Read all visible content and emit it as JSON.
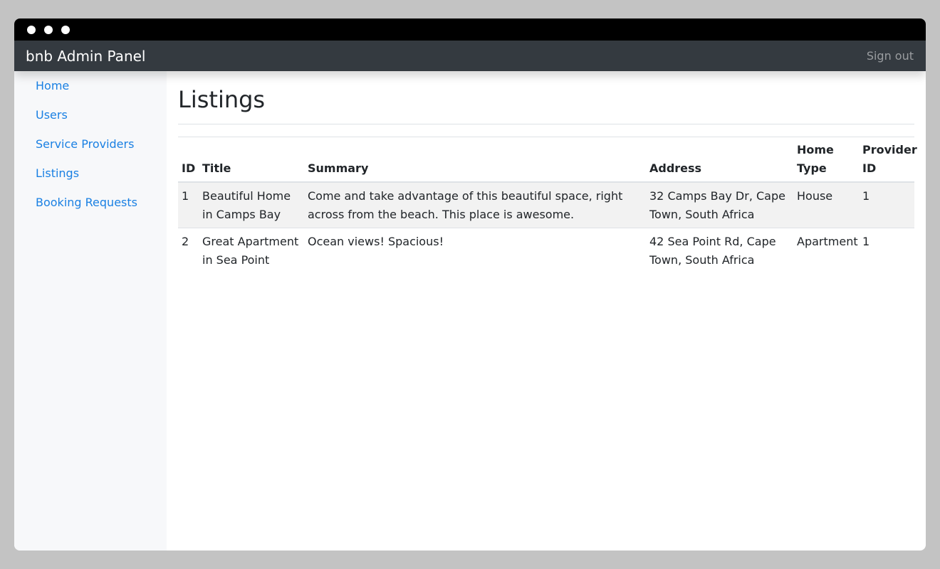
{
  "navbar": {
    "brand": "bnb Admin Panel",
    "sign_out": "Sign out"
  },
  "sidebar": {
    "items": [
      {
        "label": "Home"
      },
      {
        "label": "Users"
      },
      {
        "label": "Service Providers"
      },
      {
        "label": "Listings"
      },
      {
        "label": "Booking Requests"
      }
    ]
  },
  "main": {
    "title": "Listings",
    "table": {
      "headers": {
        "id": "ID",
        "title": "Title",
        "summary": "Summary",
        "address": "Address",
        "home_type": "Home Type",
        "provider_id": "Provider ID"
      },
      "rows": [
        {
          "id": "1",
          "title": "Beautiful Home in Camps Bay",
          "summary": "Come and take advantage of this beautiful space, right across from the beach. This place is awesome.",
          "address": "32 Camps Bay Dr, Cape Town, South Africa",
          "home_type": "House",
          "provider_id": "1"
        },
        {
          "id": "2",
          "title": "Great Apartment in Sea Point",
          "summary": "Ocean views! Spacious!",
          "address": "42 Sea Point Rd, Cape Town, South Africa",
          "home_type": "Apartment",
          "provider_id": "1"
        }
      ]
    }
  }
}
